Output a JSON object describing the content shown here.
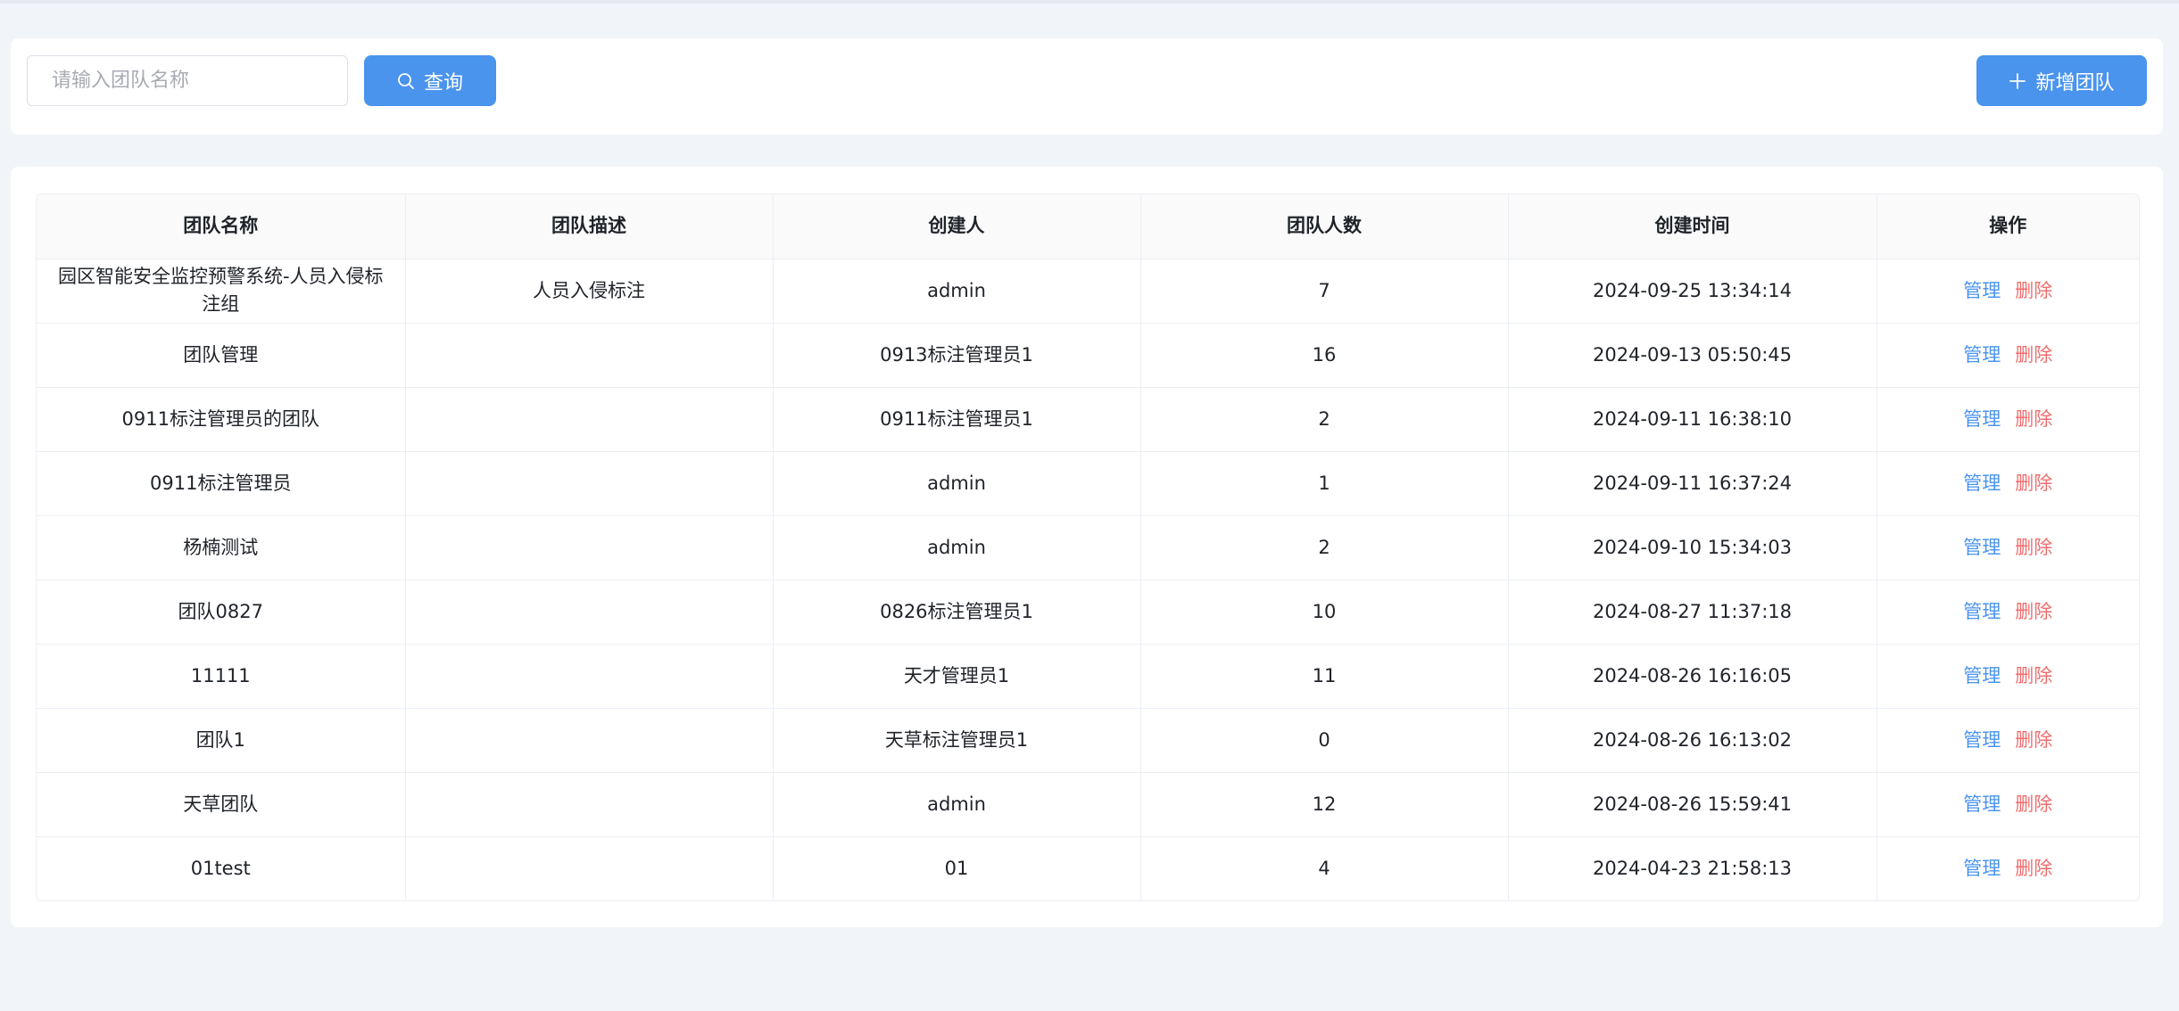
{
  "search": {
    "placeholder": "请输入团队名称",
    "value": "",
    "query_label": "查询"
  },
  "toolbar": {
    "add_label": "新增团队"
  },
  "table": {
    "headers": [
      "团队名称",
      "团队描述",
      "创建人",
      "团队人数",
      "创建时间",
      "操作"
    ],
    "manage_label": "管理",
    "delete_label": "删除",
    "rows": [
      {
        "name": "园区智能安全监控预警系统-人员入侵标注组",
        "desc": "人员入侵标注",
        "creator": "admin",
        "count": "7",
        "time": "2024-09-25 13:34:14"
      },
      {
        "name": "团队管理",
        "desc": "",
        "creator": "0913标注管理员1",
        "count": "16",
        "time": "2024-09-13 05:50:45"
      },
      {
        "name": "0911标注管理员的团队",
        "desc": "",
        "creator": "0911标注管理员1",
        "count": "2",
        "time": "2024-09-11 16:38:10"
      },
      {
        "name": "0911标注管理员",
        "desc": "",
        "creator": "admin",
        "count": "1",
        "time": "2024-09-11 16:37:24"
      },
      {
        "name": "杨楠测试",
        "desc": "",
        "creator": "admin",
        "count": "2",
        "time": "2024-09-10 15:34:03"
      },
      {
        "name": "团队0827",
        "desc": "",
        "creator": "0826标注管理员1",
        "count": "10",
        "time": "2024-08-27 11:37:18"
      },
      {
        "name": "11111",
        "desc": "",
        "creator": "天才管理员1",
        "count": "11",
        "time": "2024-08-26 16:16:05"
      },
      {
        "name": "团队1",
        "desc": "",
        "creator": "天草标注管理员1",
        "count": "0",
        "time": "2024-08-26 16:13:02"
      },
      {
        "name": "天草团队",
        "desc": "",
        "creator": "admin",
        "count": "12",
        "time": "2024-08-26 15:59:41"
      },
      {
        "name": "01test",
        "desc": "",
        "creator": "01",
        "count": "4",
        "time": "2024-04-23 21:58:13"
      }
    ]
  },
  "icons": {
    "query": "search-icon",
    "add": "plus-icon"
  },
  "colors": {
    "primary": "#4a94ee",
    "danger": "#f26d6d",
    "page_bg": "#f1f4f8"
  }
}
